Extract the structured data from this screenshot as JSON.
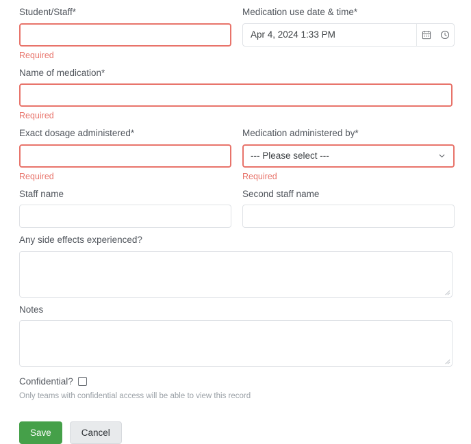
{
  "fields": {
    "student_staff": {
      "label": "Student/Staff*",
      "value": "",
      "error": "Required"
    },
    "med_datetime": {
      "label": "Medication use date & time*",
      "value": "Apr 4, 2024 1:33 PM",
      "calendar_icon": "calendar-icon",
      "clock_icon": "clock-icon"
    },
    "med_name": {
      "label": "Name of medication*",
      "value": "",
      "error": "Required"
    },
    "dosage": {
      "label": "Exact dosage administered*",
      "value": "",
      "error": "Required"
    },
    "administered_by": {
      "label": "Medication administered by*",
      "selected": "--- Please select ---",
      "error": "Required",
      "chevron_icon": "chevron-down-icon"
    },
    "staff_name": {
      "label": "Staff name",
      "value": ""
    },
    "second_staff_name": {
      "label": "Second staff name",
      "value": ""
    },
    "side_effects": {
      "label": "Any side effects experienced?",
      "value": ""
    },
    "notes": {
      "label": "Notes",
      "value": ""
    },
    "confidential": {
      "label": "Confidential?",
      "checked": false,
      "help": "Only teams with confidential access will be able to view this record"
    }
  },
  "actions": {
    "save_label": "Save",
    "cancel_label": "Cancel"
  },
  "colors": {
    "error": "#e8736a",
    "save_bg": "#45a049",
    "cancel_bg": "#e8eaec",
    "label": "#50555c",
    "border": "#dfe2e6"
  }
}
